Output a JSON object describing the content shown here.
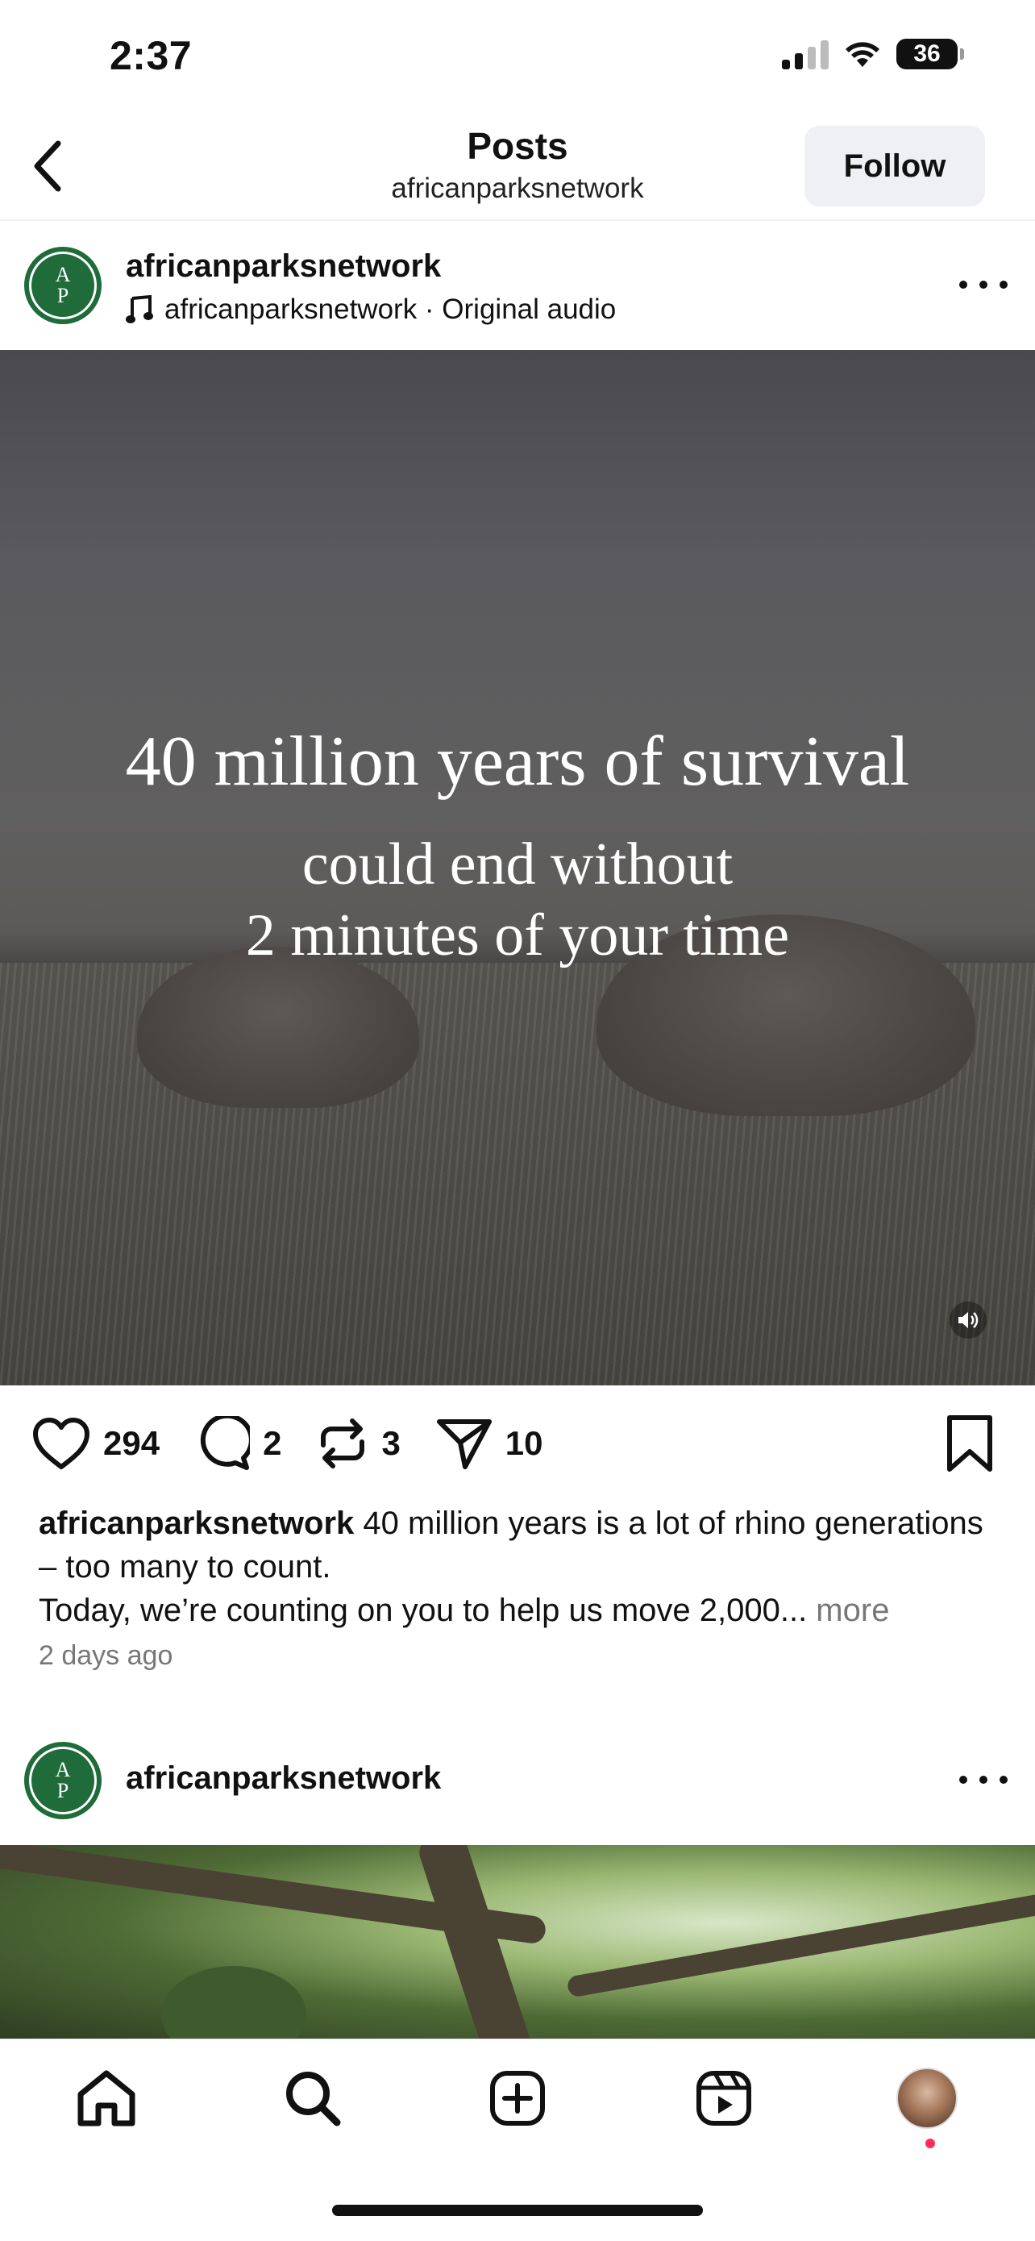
{
  "status_bar": {
    "time": "2:37",
    "battery": "36"
  },
  "header": {
    "title": "Posts",
    "subtitle": "africanparksnetwork",
    "follow_label": "Follow"
  },
  "post1": {
    "username": "africanparksnetwork",
    "audio": "africanparksnetwork · Original audio",
    "avatar_letters": [
      "A",
      "P"
    ],
    "overlay_line1": "40 million years of survival",
    "overlay_line2": "could end without",
    "overlay_line3": "2 minutes of your time",
    "likes": "294",
    "comments": "2",
    "reposts": "3",
    "shares": "10",
    "caption_user": "africanparksnetwork",
    "caption_text_1": " 40 million years is a lot of rhino generations – too many to count.",
    "caption_text_2": "Today, we’re counting on you to help us move 2,000...",
    "caption_more": " more",
    "timestamp": "2 days ago"
  },
  "post2": {
    "username": "africanparksnetwork",
    "avatar_letters": [
      "A",
      "P"
    ]
  },
  "tabbar": {
    "items": [
      "home-icon",
      "search-icon",
      "create-icon",
      "reels-icon",
      "profile-avatar"
    ]
  },
  "colors": {
    "brand_green": "#1f6b3a",
    "notification": "#ff2d55",
    "follow_bg": "#eef0f3"
  }
}
